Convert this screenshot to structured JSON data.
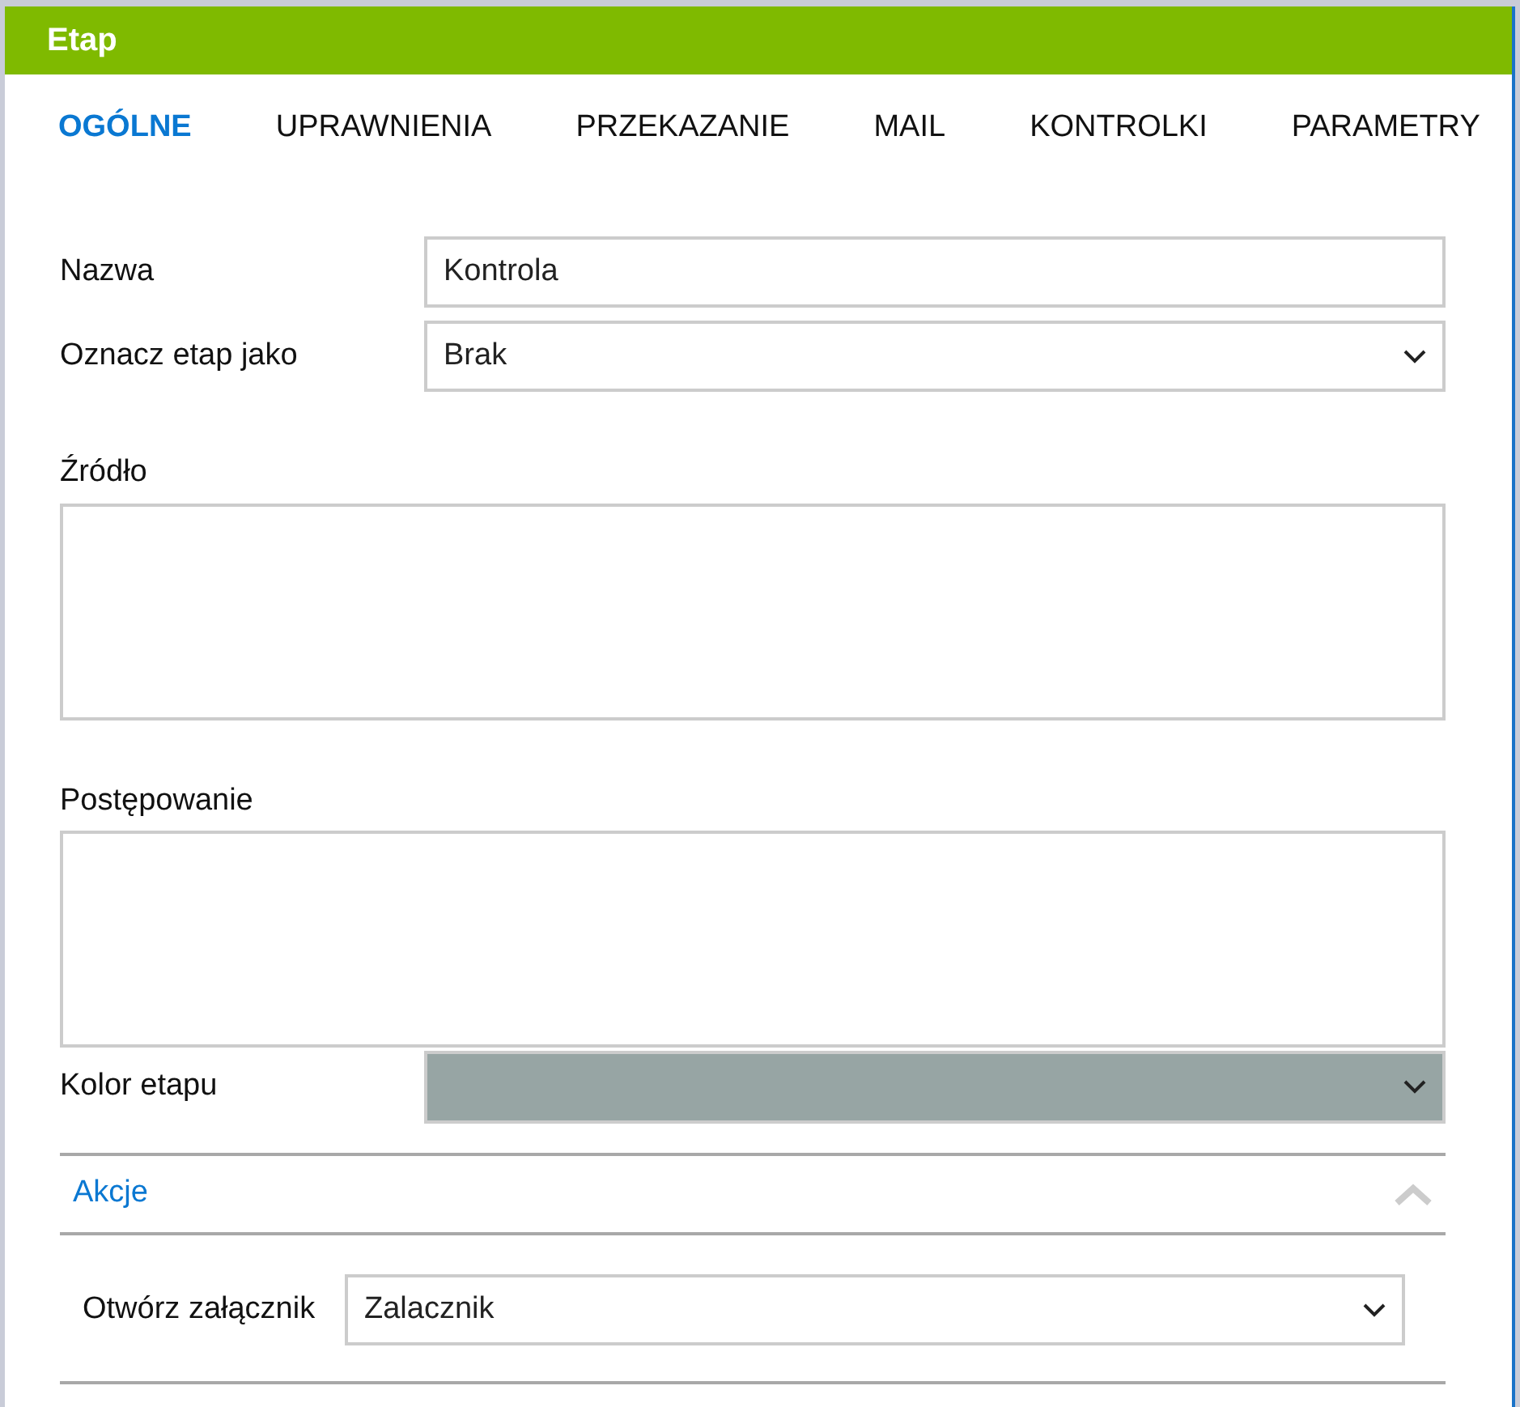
{
  "window": {
    "title": "Etap"
  },
  "tabs": [
    {
      "label": "OGÓLNE",
      "selected": true
    },
    {
      "label": "UPRAWNIENIA",
      "selected": false
    },
    {
      "label": "PRZEKAZANIE",
      "selected": false
    },
    {
      "label": "MAIL",
      "selected": false
    },
    {
      "label": "KONTROLKI",
      "selected": false
    },
    {
      "label": "PARAMETRY",
      "selected": false
    }
  ],
  "fields": [
    {
      "kind": "text",
      "label": "Nazwa",
      "value": "Kontrola"
    },
    {
      "kind": "select",
      "label": "Oznacz etap jako",
      "value": "Brak"
    },
    {
      "kind": "textarea",
      "label": "Źródło"
    },
    {
      "kind": "textarea",
      "label": "Postępowanie"
    },
    {
      "kind": "color",
      "label": "Kolor etapu",
      "color": "#97a5a4"
    }
  ],
  "section": {
    "title": "Akcje",
    "expanded": true,
    "fields": [
      {
        "kind": "select",
        "label": "Otwórz załącznik",
        "value": "Zalacznik"
      }
    ]
  }
}
